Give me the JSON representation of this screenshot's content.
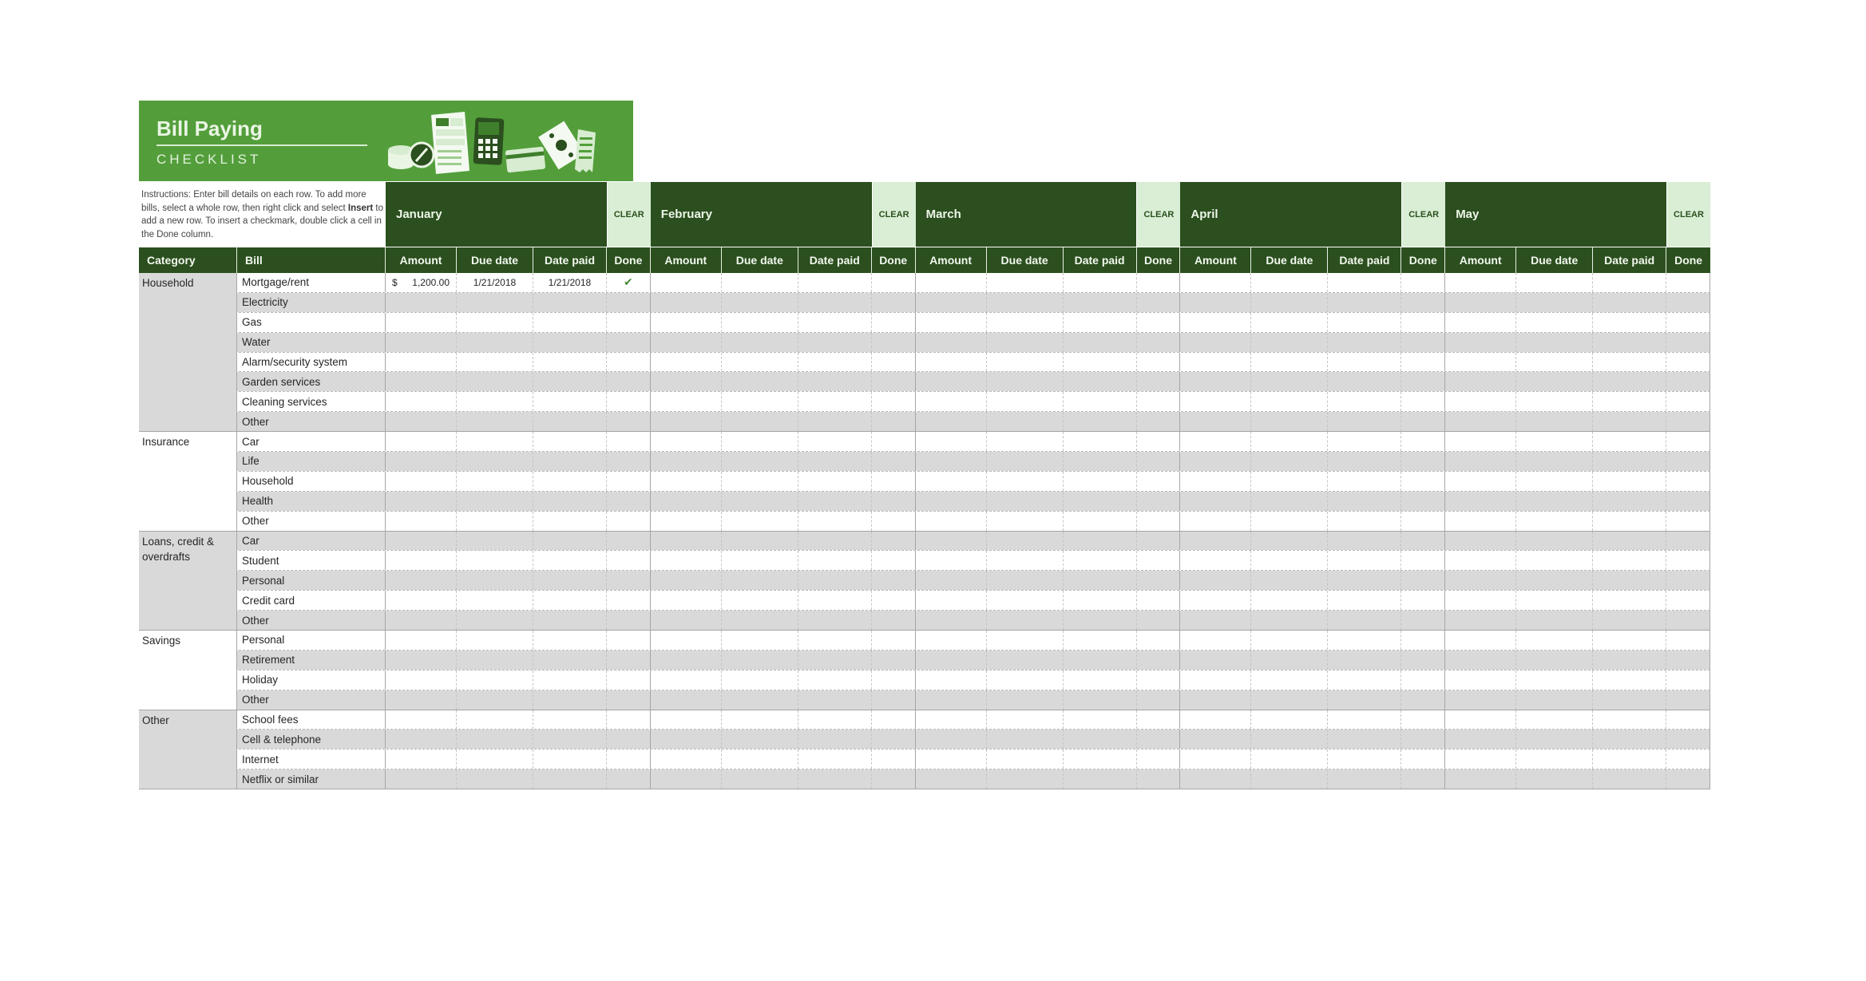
{
  "banner": {
    "title": "Bill Paying",
    "subtitle": "CHECKLIST",
    "illustration": "bills-coins-calculator-card-cash-icon",
    "color": "#539e3b"
  },
  "instructions": {
    "before": "Instructions: Enter bill details on each row. To add more bills, select a whole row, then right click and select ",
    "bold": "Insert",
    "after": " to add a new row. To insert a checkmark, double click a cell in the Done column."
  },
  "colors": {
    "header_dark": "#2b4f1e",
    "clear_bg": "#d9eed5",
    "stripe": "#d9d9d9"
  },
  "months": [
    {
      "name": "January",
      "clear_label": "CLEAR"
    },
    {
      "name": "February",
      "clear_label": "CLEAR"
    },
    {
      "name": "March",
      "clear_label": "CLEAR"
    },
    {
      "name": "April",
      "clear_label": "CLEAR"
    },
    {
      "name": "May",
      "clear_label": "CLEAR"
    }
  ],
  "columns": {
    "category": "Category",
    "bill": "Bill",
    "month_columns": [
      "Amount",
      "Due date",
      "Date paid",
      "Done"
    ]
  },
  "categories": [
    {
      "name": "Household",
      "bills": [
        "Mortgage/rent",
        "Electricity",
        "Gas",
        "Water",
        "Alarm/security system",
        "Garden services",
        "Cleaning services",
        "Other"
      ]
    },
    {
      "name": "Insurance",
      "bills": [
        "Car",
        "Life",
        "Household",
        "Health",
        "Other"
      ]
    },
    {
      "name": "Loans, credit & overdrafts",
      "bills": [
        "Car",
        "Student",
        "Personal",
        "Credit card",
        "Other"
      ]
    },
    {
      "name": "Savings",
      "bills": [
        "Personal",
        "Retirement",
        "Holiday",
        "Other"
      ]
    },
    {
      "name": "Other",
      "bills": [
        "School fees",
        "Cell & telephone",
        "Internet",
        "Netflix or similar"
      ]
    }
  ],
  "entries": [
    {
      "row": 0,
      "month": 0,
      "currency": "$",
      "amount": "1,200.00",
      "due_date": "1/21/2018",
      "date_paid": "1/21/2018",
      "done": true,
      "done_icon": "checkmark-icon"
    }
  ]
}
